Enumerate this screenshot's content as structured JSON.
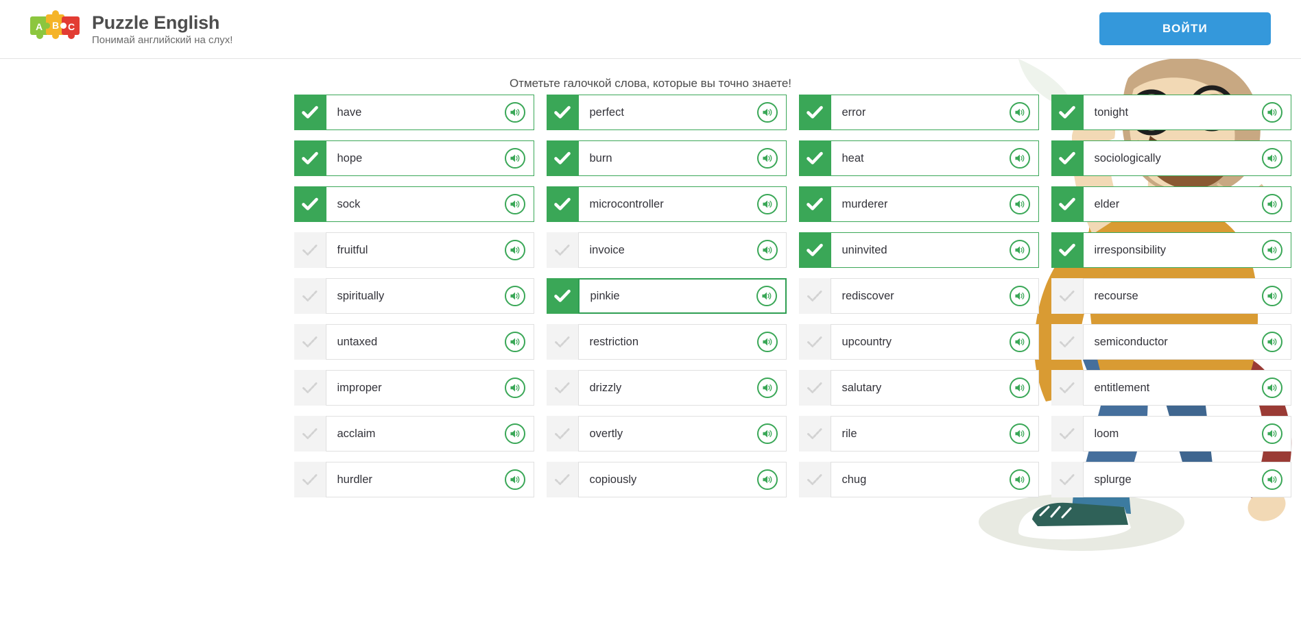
{
  "header": {
    "logo": {
      "icon": "puzzle-abc-logo",
      "letters": [
        "A",
        "B",
        "C"
      ],
      "colors": {
        "a": "#8cc63e",
        "b": "#f5b428",
        "c": "#e23c33"
      }
    },
    "brand_title": "Puzzle English",
    "brand_tagline": "Понимай английский на слух!",
    "login_label": "ВОЙТИ",
    "login_color": "#3498db"
  },
  "main": {
    "instruction": "Отметьте галочкой слова, которые вы точно знаете!",
    "checked_color": "#3aa757",
    "unchecked_color": "#f3f3f3",
    "speaker_icon": "speaker-icon",
    "check_icon": "check-icon",
    "words": [
      {
        "label": "have",
        "checked": true,
        "active": false
      },
      {
        "label": "perfect",
        "checked": true,
        "active": false
      },
      {
        "label": "error",
        "checked": true,
        "active": false
      },
      {
        "label": "tonight",
        "checked": true,
        "active": false
      },
      {
        "label": "hope",
        "checked": true,
        "active": false
      },
      {
        "label": "burn",
        "checked": true,
        "active": false
      },
      {
        "label": "heat",
        "checked": true,
        "active": false
      },
      {
        "label": "sociologically",
        "checked": true,
        "active": false
      },
      {
        "label": "sock",
        "checked": true,
        "active": false
      },
      {
        "label": "microcontroller",
        "checked": true,
        "active": false
      },
      {
        "label": "murderer",
        "checked": true,
        "active": false
      },
      {
        "label": "elder",
        "checked": true,
        "active": false
      },
      {
        "label": "fruitful",
        "checked": false,
        "active": false
      },
      {
        "label": "invoice",
        "checked": false,
        "active": false
      },
      {
        "label": "uninvited",
        "checked": true,
        "active": false
      },
      {
        "label": "irresponsibility",
        "checked": true,
        "active": false
      },
      {
        "label": "spiritually",
        "checked": false,
        "active": false
      },
      {
        "label": "pinkie",
        "checked": true,
        "active": true
      },
      {
        "label": "rediscover",
        "checked": false,
        "active": false
      },
      {
        "label": "recourse",
        "checked": false,
        "active": false
      },
      {
        "label": "untaxed",
        "checked": false,
        "active": false
      },
      {
        "label": "restriction",
        "checked": false,
        "active": false
      },
      {
        "label": "upcountry",
        "checked": false,
        "active": false
      },
      {
        "label": "semiconductor",
        "checked": false,
        "active": false
      },
      {
        "label": "improper",
        "checked": false,
        "active": false
      },
      {
        "label": "drizzly",
        "checked": false,
        "active": false
      },
      {
        "label": "salutary",
        "checked": false,
        "active": false
      },
      {
        "label": "entitlement",
        "checked": false,
        "active": false
      },
      {
        "label": "acclaim",
        "checked": false,
        "active": false
      },
      {
        "label": "overtly",
        "checked": false,
        "active": false
      },
      {
        "label": "rile",
        "checked": false,
        "active": false
      },
      {
        "label": "loom",
        "checked": false,
        "active": false
      },
      {
        "label": "hurdler",
        "checked": false,
        "active": false
      },
      {
        "label": "copiously",
        "checked": false,
        "active": false
      },
      {
        "label": "chug",
        "checked": false,
        "active": false
      },
      {
        "label": "splurge",
        "checked": false,
        "active": false
      }
    ]
  },
  "illustration": {
    "name": "man-with-glasses-illustration",
    "colors": {
      "sweater": "#d99b33",
      "skin": "#f2d9b5",
      "hair": "#c8a882",
      "beard": "#8a5a33",
      "jeans": "#456f9c",
      "shoe": "#2f6158",
      "shadow": "#e8eae2"
    }
  }
}
